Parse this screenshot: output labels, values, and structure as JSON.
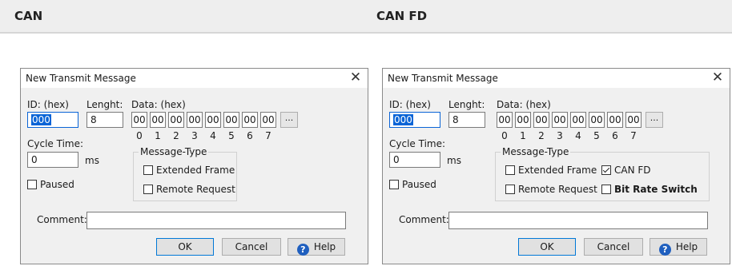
{
  "headers": {
    "left": "CAN",
    "right": "CAN FD"
  },
  "dialogs": [
    {
      "title": "New Transmit Message",
      "id_label": "ID: (hex)",
      "id_value": "000",
      "length_label": "Lenght:",
      "length_value": "8",
      "data_label": "Data: (hex)",
      "data_bytes": [
        "00",
        "00",
        "00",
        "00",
        "00",
        "00",
        "00",
        "00"
      ],
      "data_index": [
        "0",
        "1",
        "2",
        "3",
        "4",
        "5",
        "6",
        "7"
      ],
      "more_label": "...",
      "cycle_label": "Cycle Time:",
      "cycle_value": "0",
      "cycle_unit": "ms",
      "paused_label": "Paused",
      "paused_checked": false,
      "message_type_label": "Message-Type",
      "extended_label": "Extended Frame",
      "remote_label": "Remote Request",
      "comment_label": "Comment:",
      "comment_value": "",
      "ok_label": "OK",
      "cancel_label": "Cancel",
      "help_label": "Help",
      "help_icon_glyph": "?"
    },
    {
      "title": "New Transmit Message",
      "id_label": "ID: (hex)",
      "id_value": "000",
      "length_label": "Lenght:",
      "length_value": "8",
      "data_label": "Data: (hex)",
      "data_bytes": [
        "00",
        "00",
        "00",
        "00",
        "00",
        "00",
        "00",
        "00"
      ],
      "data_index": [
        "0",
        "1",
        "2",
        "3",
        "4",
        "5",
        "6",
        "7"
      ],
      "more_label": "...",
      "cycle_label": "Cycle Time:",
      "cycle_value": "0",
      "cycle_unit": "ms",
      "paused_label": "Paused",
      "paused_checked": false,
      "message_type_label": "Message-Type",
      "extended_label": "Extended Frame",
      "remote_label": "Remote Request",
      "canfd_label": "CAN FD",
      "canfd_checked": true,
      "brs_label": "Bit Rate Switch",
      "brs_checked": false,
      "comment_label": "Comment:",
      "comment_value": "",
      "ok_label": "OK",
      "cancel_label": "Cancel",
      "help_label": "Help",
      "help_icon_glyph": "?"
    }
  ],
  "colors": {
    "selection": "#0a64d6",
    "help_icon": "#1f5fbf",
    "default_button_border": "#0078d7"
  }
}
